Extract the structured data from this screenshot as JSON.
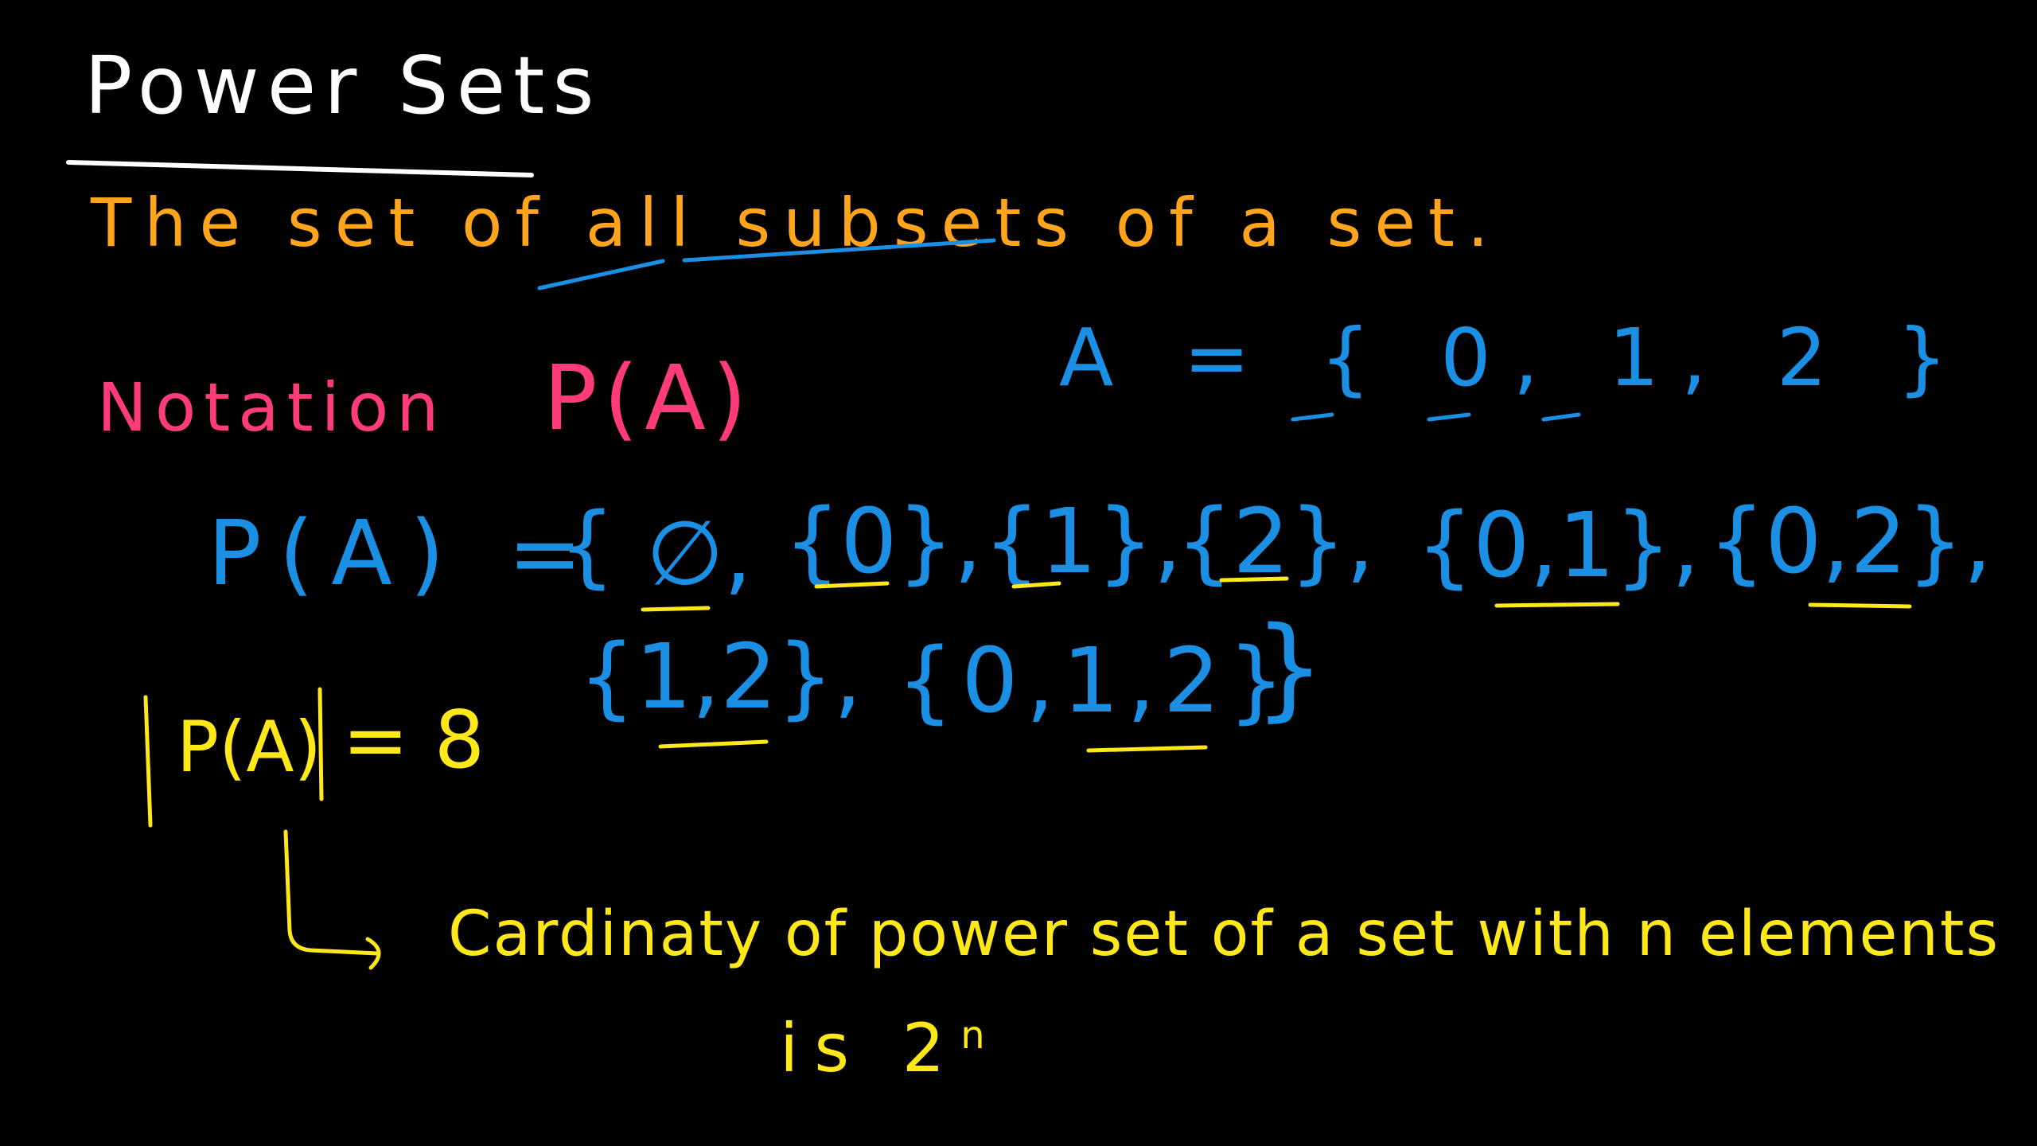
{
  "title": "Power Sets",
  "definition": {
    "before": "The set of ",
    "all": "all",
    "subsets": "subsets",
    "after": " of a set."
  },
  "notation": {
    "label": "Notation",
    "symbol": "P(A)"
  },
  "set_a": "A = { 0, 1, 2 }",
  "power_set": {
    "lhs": "P(A) =",
    "open": "{",
    "elements": [
      "∅,",
      "{0},",
      "{1},",
      "{2},",
      "{0,1},",
      "{0,2},",
      "{1,2},",
      "{0,1,2}"
    ],
    "close": "}"
  },
  "cardinality": {
    "lhs": "P(A)",
    "rhs": "= 8"
  },
  "note": {
    "line1": "Cardinaty of power set of a set with n elements",
    "line2": "is 2",
    "exponent": "n"
  },
  "colors": {
    "title": "#ffffff",
    "definition": "#ffa41b",
    "notation": "#ff3b7a",
    "sets": "#1a8fe3",
    "notes": "#ffe81a"
  }
}
